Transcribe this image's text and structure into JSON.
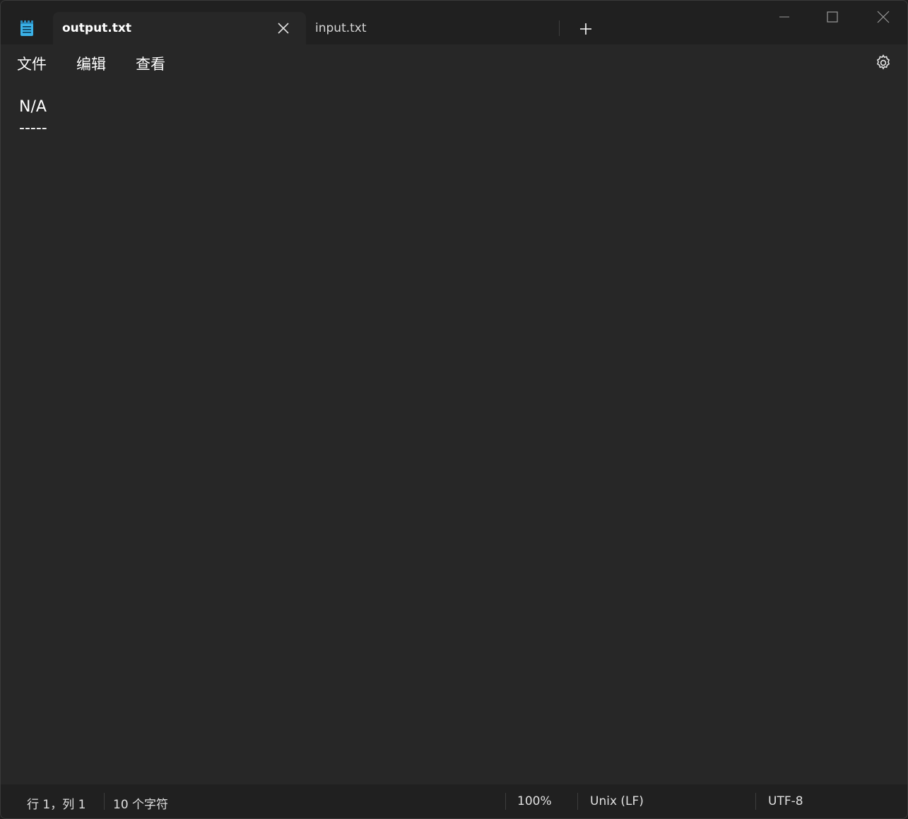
{
  "tabs": [
    {
      "label": "output.txt",
      "active": true
    },
    {
      "label": "input.txt",
      "active": false
    }
  ],
  "menu": {
    "file": "文件",
    "edit": "编辑",
    "view": "查看"
  },
  "editor": {
    "content": "N/A\n-----"
  },
  "status": {
    "position": "行 1，列 1",
    "char_count": "10 个字符",
    "zoom": "100%",
    "line_ending": "Unix (LF)",
    "encoding": "UTF-8"
  },
  "icons": {
    "app": "notepad-icon",
    "close_tab": "close-icon",
    "new_tab": "plus-icon",
    "settings": "gear-icon"
  },
  "colors": {
    "app_icon": "#3bb2e8"
  }
}
